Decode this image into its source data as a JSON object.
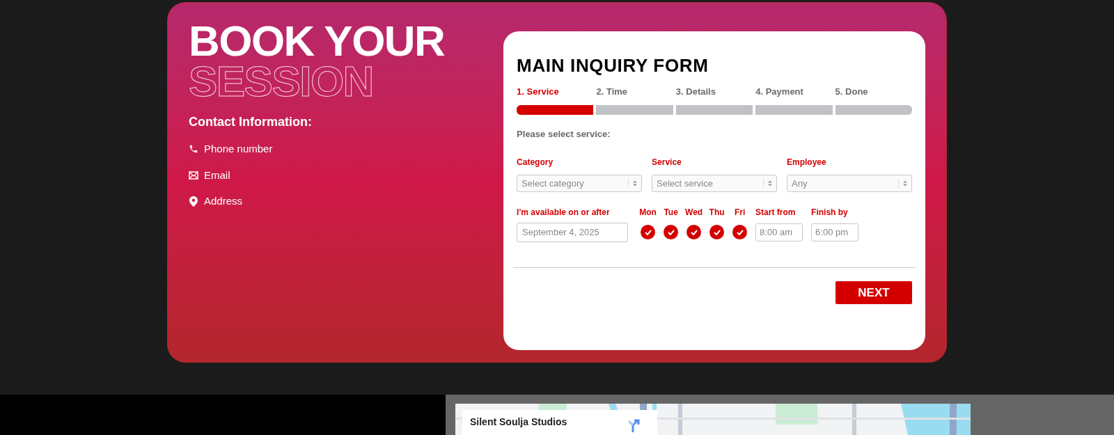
{
  "hero": {
    "title_line_1": "BOOK YOUR",
    "title_line_2": "SESSION",
    "contact_heading": "Contact Information:",
    "contacts": [
      {
        "kind": "phone",
        "label": "Phone number"
      },
      {
        "kind": "email",
        "label": "Email"
      },
      {
        "kind": "address",
        "label": "Address"
      }
    ]
  },
  "form": {
    "title": "MAIN INQUIRY FORM",
    "steps": [
      {
        "label": "1. Service",
        "selected": true
      },
      {
        "label": "2. Time",
        "selected": false
      },
      {
        "label": "3. Details",
        "selected": false
      },
      {
        "label": "4. Payment",
        "selected": false
      },
      {
        "label": "5. Done",
        "selected": false
      }
    ],
    "prompt": "Please select service:",
    "selects": [
      {
        "label": "Category",
        "placeholder": "Select category"
      },
      {
        "label": "Service",
        "placeholder": "Select service"
      },
      {
        "label": "Employee",
        "placeholder": "Any"
      }
    ],
    "date": {
      "label": "I'm available on or after",
      "value": "September 4, 2025"
    },
    "days": [
      {
        "label": "Mon",
        "checked": true
      },
      {
        "label": "Tue",
        "checked": true
      },
      {
        "label": "Wed",
        "checked": true
      },
      {
        "label": "Thu",
        "checked": true
      },
      {
        "label": "Fri",
        "checked": true
      }
    ],
    "start": {
      "label": "Start from",
      "value": "8:00 am"
    },
    "finish": {
      "label": "Finish by",
      "value": "6:00 pm"
    },
    "next_button": "NEXT"
  },
  "map": {
    "place_name": "Silent Soulja Studios"
  }
}
